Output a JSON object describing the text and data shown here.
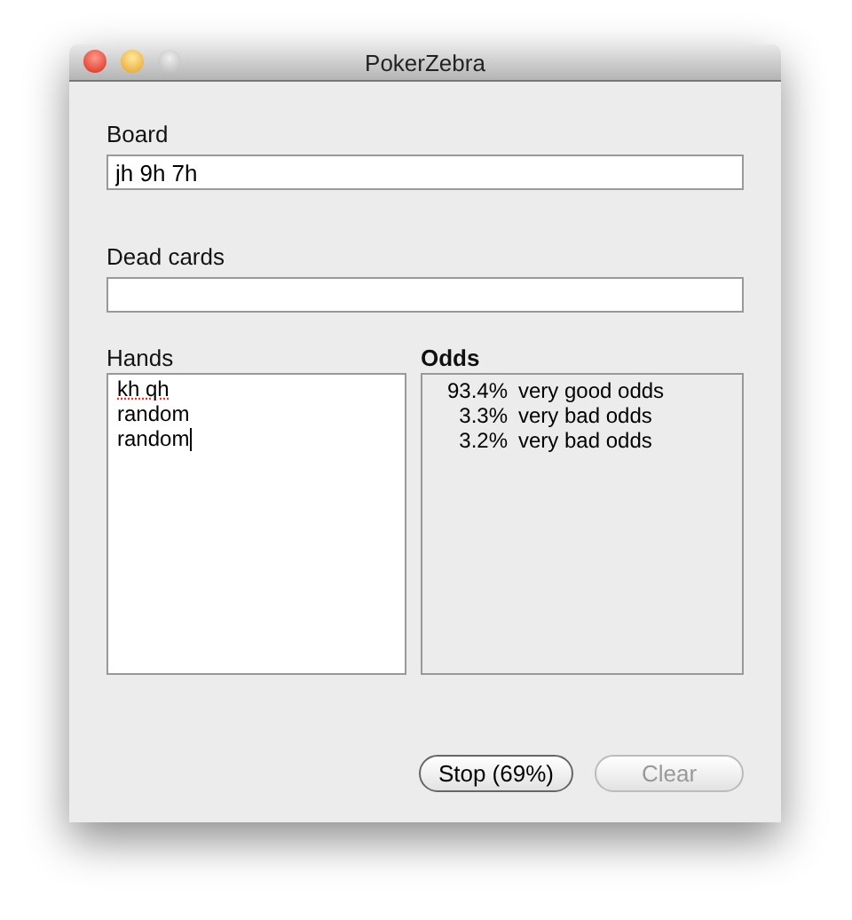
{
  "window": {
    "title": "PokerZebra"
  },
  "board": {
    "label": "Board",
    "value": "jh 9h 7h"
  },
  "dead_cards": {
    "label": "Dead cards"
  },
  "hands": {
    "label": "Hands",
    "lines": [
      "kh qh",
      "random",
      "random"
    ]
  },
  "odds": {
    "label": "Odds",
    "rows": [
      {
        "percent": "93.4%",
        "verdict": "very good odds"
      },
      {
        "percent": "3.3%",
        "verdict": "very bad odds"
      },
      {
        "percent": "3.2%",
        "verdict": "very bad odds"
      }
    ]
  },
  "buttons": [
    {
      "label": "Stop (69%)",
      "disabled": false
    },
    {
      "label": "Clear",
      "disabled": true
    }
  ]
}
